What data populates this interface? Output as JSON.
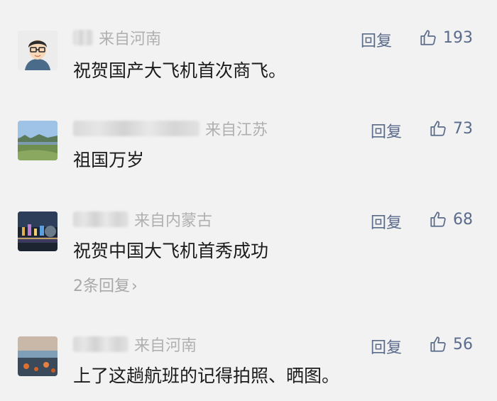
{
  "comments": [
    {
      "location": "来自河南",
      "text": "祝贺国产大飞机首次商飞。",
      "reply_label": "回复",
      "likes": "193",
      "avatar": "cartoon-boy-with-glasses"
    },
    {
      "location": "来自江苏",
      "text": "祖国万岁",
      "reply_label": "回复",
      "likes": "73",
      "avatar": "lake-landscape"
    },
    {
      "location": "来自内蒙古",
      "text": "祝贺中国大飞机首秀成功",
      "reply_label": "回复",
      "likes": "68",
      "avatar": "night-city-lights",
      "sub_replies": "2条回复"
    },
    {
      "location": "来自河南",
      "text": "上了这趟航班的记得拍照、晒图。",
      "reply_label": "回复",
      "likes": "56",
      "avatar": "sunset-coast"
    }
  ],
  "icons": {
    "like": "thumbs-up-icon",
    "chevron": "chevron-right-icon"
  },
  "colors": {
    "background": "#f2f2f2",
    "link": "#5a6b8c",
    "meta": "#b0b0b0",
    "text": "#1b1b1b"
  }
}
